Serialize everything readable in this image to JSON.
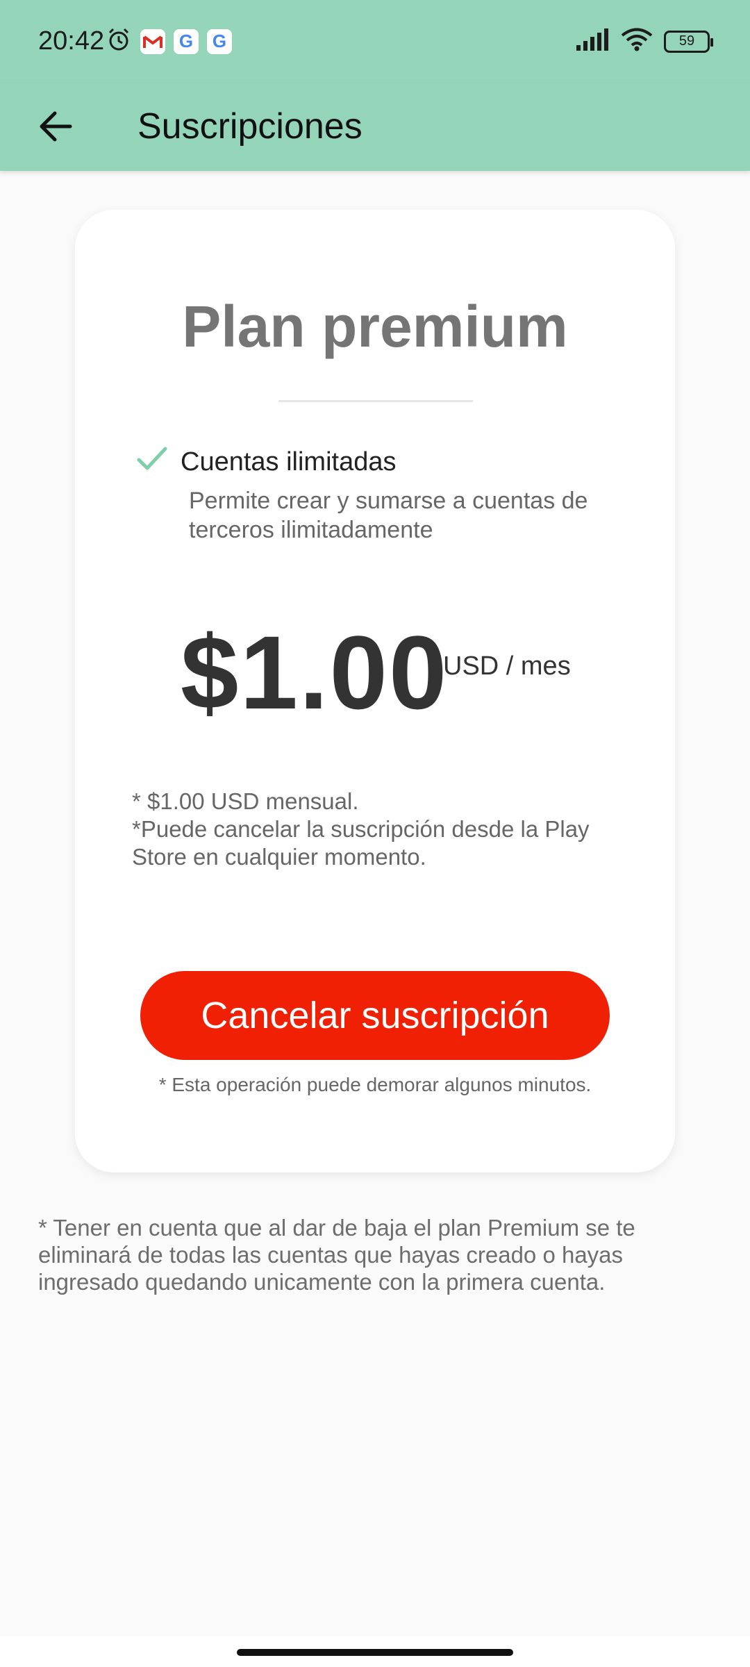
{
  "status_bar": {
    "time": "20:42",
    "notifications": [
      "alarm-icon",
      "gmail-icon",
      "google-icon",
      "google-icon"
    ],
    "battery": "59"
  },
  "app_bar": {
    "title": "Suscripciones"
  },
  "plan": {
    "title": "Plan premium",
    "feature_title": "Cuentas ilimitadas",
    "feature_desc": "Permite crear y sumarse a cuentas de terceros ilimitadamente",
    "price": "$1.00",
    "price_unit": "USD / mes",
    "note_1": "* $1.00 USD mensual.",
    "note_2": "*Puede cancelar la suscripción desde la Play Store en cualquier momento.",
    "cancel_label": "Cancelar suscripción",
    "operation_note": "* Esta operación puede demorar algunos minutos."
  },
  "footer_note": "* Tener en cuenta que al dar de baja el plan Premium se te eliminará de todas las cuentas que hayas creado o hayas ingresado quedando unicamente con la primera cuenta.",
  "colors": {
    "app_bar": "#94d4b9",
    "cancel_button": "#f02005",
    "check": "#7fcfaa"
  }
}
